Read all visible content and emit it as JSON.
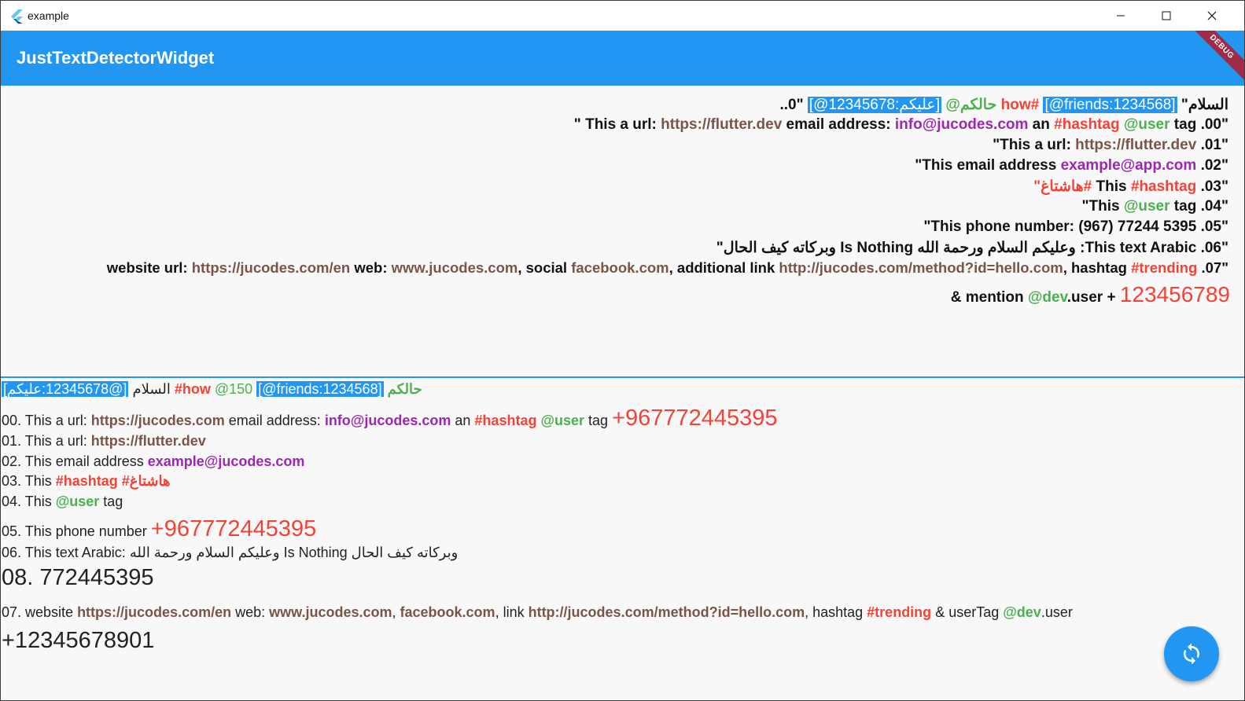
{
  "window": {
    "title": "example"
  },
  "appbar": {
    "title": "JustTextDetectorWidget",
    "debug_banner": "DEBUG"
  },
  "colors": {
    "primary": "#2196f3",
    "url": "#795548",
    "email": "#9c27b0",
    "hashtag": "#f44336",
    "mention": "#4caf50",
    "phone": "#f44336"
  },
  "top": {
    "l0": {
      "a": "\"السلام ",
      "b": "[@friends:1234568]",
      "c": " how#",
      "d": " @حالكم ",
      "e": "[@12345678:عليكم]",
      "f": " ..0\""
    },
    "l1": {
      "a": "\" This  a url: ",
      "b": "https://flutter.dev",
      "c": " email address: ",
      "d": "info@jucodes.com",
      "e": " an ",
      "f": "#hashtag",
      "g": " ",
      "h": "@user",
      "i": " tag .00\""
    },
    "l2": {
      "a": "\"This  a url: ",
      "b": "https://flutter.dev",
      "c": " .01\""
    },
    "l3": {
      "a": "\"This email address ",
      "b": "example@app.com",
      "c": " .02\""
    },
    "l4": {
      "a": "\"هاشتاغ#",
      "b": " This  ",
      "c": "#hashtag",
      "d": " .03\""
    },
    "l5": {
      "a": "\"This ",
      "b": "@user",
      "c": " tag .04\""
    },
    "l6": {
      "a": "\"This  phone number: (967) 77244 5395 .05\""
    },
    "l7": {
      "a": "\"وبركاته كيف الحال Is Nothing وعليكم السلام ورحمة الله :This text Arabic .06\""
    },
    "l8": {
      "a": "website url: ",
      "b": "https://jucodes.com/en",
      "c": "  web: ",
      "d": "www.jucodes.com",
      "e": ", social ",
      "f": "facebook.com",
      "g": ", additional link ",
      "h": "http://jucodes.com/method?id=hello.com",
      "i": ", hashtag ",
      "j": "#trending",
      "k": " .07\""
    },
    "l9": {
      "a": "& mention ",
      "b": "@dev",
      "c": ".user + ",
      "d": "123456789"
    }
  },
  "bottom": {
    "l0": {
      "a": "السلام ",
      "b": "[@12345678:عليكم]",
      "c": " #how",
      "d": " @150 ",
      "e": "[@friends:1234568]",
      "f": " حالكم"
    },
    "l1": {
      "a": "00. This  a url: ",
      "b": "https://jucodes.com",
      "c": " email address: ",
      "d": "info@jucodes.com",
      "e": " an ",
      "f": "#hashtag",
      "g": " ",
      "h": "@user",
      "i": " tag  ",
      "j": "+967772445395"
    },
    "l2": {
      "a": "01. This  a url: ",
      "b": "https://flutter.dev"
    },
    "l3": {
      "a": "02. This email address ",
      "b": "example@jucodes.com"
    },
    "l4": {
      "a": "03. This  ",
      "b": "#hashtag",
      "c": " #هاشتاغ"
    },
    "l5": {
      "a": "04. This ",
      "b": "@user",
      "c": " tag"
    },
    "l6": {
      "a": "05. This  phone number  ",
      "b": "+967772445395"
    },
    "l7": {
      "a": "06. This text Arabic: وعليكم السلام ورحمة الله Is Nothing وبركاته كيف الحال"
    },
    "l8": {
      "a": "08. 772445395"
    },
    "l9": {
      "a": "07. website  ",
      "b": "https://jucodes.com/en",
      "c": "  web: ",
      "d": "www.jucodes.com",
      "e": ",  ",
      "f": "facebook.com",
      "g": ",  link ",
      "h": "http://jucodes.com/method?id=hello.com",
      "i": ", hashtag ",
      "j": "#trending",
      "k": " & userTag ",
      "l": "@dev",
      "m": ".user"
    },
    "l10": {
      "a": "+12345678901"
    }
  },
  "fab": {
    "icon": "sync-icon"
  }
}
